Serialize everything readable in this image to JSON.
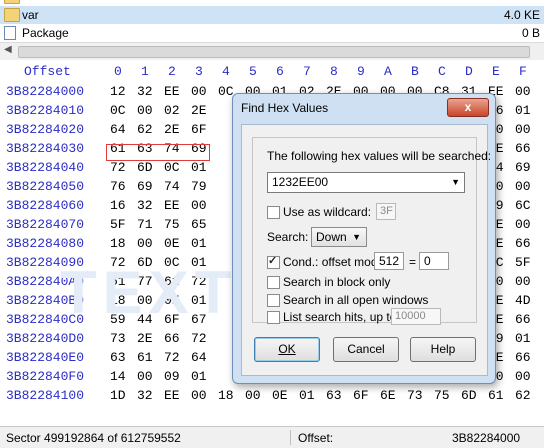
{
  "filelist": {
    "rows": [
      {
        "name": "",
        "size": "",
        "icon": "folder-icon"
      },
      {
        "name": "var",
        "size": "4.0 KE",
        "icon": "folder-icon"
      },
      {
        "name": "Package",
        "size": "0 B",
        "icon": "file-icon"
      }
    ]
  },
  "hex": {
    "offset_label": "Offset",
    "columns": [
      "0",
      "1",
      "2",
      "3",
      "4",
      "5",
      "6",
      "7",
      "8",
      "9",
      "A",
      "B",
      "C",
      "D",
      "E",
      "F"
    ],
    "rows": [
      {
        "offset": "3B82284000",
        "bytes": [
          "12",
          "32",
          "EE",
          "00",
          "0C",
          "00",
          "01",
          "02",
          "2E",
          "00",
          "00",
          "00",
          "C8",
          "31",
          "EE",
          "00"
        ]
      },
      {
        "offset": "3B82284010",
        "bytes": [
          "0C",
          "00",
          "02",
          "2E",
          "",
          "",
          "",
          "",
          "",
          "",
          "",
          "",
          "",
          "",
          "06",
          "01"
        ]
      },
      {
        "offset": "3B82284020",
        "bytes": [
          "64",
          "62",
          "2E",
          "6F",
          "",
          "",
          "",
          "",
          "",
          "",
          "",
          "",
          "",
          "",
          "00",
          "00"
        ]
      },
      {
        "offset": "3B82284030",
        "bytes": [
          "61",
          "63",
          "74",
          "69",
          "",
          "",
          "",
          "",
          "",
          "",
          "",
          "",
          "",
          "",
          "2E",
          "66"
        ]
      },
      {
        "offset": "3B82284040",
        "bytes": [
          "72",
          "6D",
          "0C",
          "01",
          "",
          "",
          "",
          "",
          "",
          "",
          "",
          "",
          "",
          "",
          "74",
          "69"
        ]
      },
      {
        "offset": "3B82284050",
        "bytes": [
          "76",
          "69",
          "74",
          "79",
          "",
          "",
          "",
          "",
          "",
          "",
          "",
          "",
          "",
          "",
          "00",
          "00"
        ]
      },
      {
        "offset": "3B82284060",
        "bytes": [
          "16",
          "32",
          "EE",
          "00",
          "",
          "",
          "",
          "",
          "",
          "",
          "",
          "",
          "",
          "",
          "69",
          "6C"
        ]
      },
      {
        "offset": "3B82284070",
        "bytes": [
          "5F",
          "71",
          "75",
          "65",
          "",
          "",
          "",
          "",
          "",
          "",
          "",
          "",
          "",
          "",
          "EE",
          "00"
        ]
      },
      {
        "offset": "3B82284080",
        "bytes": [
          "18",
          "00",
          "0E",
          "01",
          "",
          "",
          "",
          "",
          "",
          "",
          "",
          "",
          "",
          "",
          "2E",
          "66"
        ]
      },
      {
        "offset": "3B82284090",
        "bytes": [
          "72",
          "6D",
          "0C",
          "01",
          "",
          "",
          "",
          "",
          "",
          "",
          "",
          "",
          "",
          "",
          "6C",
          "5F"
        ]
      },
      {
        "offset": "3B822840A0",
        "bytes": [
          "61",
          "77",
          "61",
          "72",
          "",
          "",
          "",
          "",
          "",
          "",
          "",
          "",
          "",
          "",
          "00",
          "00"
        ]
      },
      {
        "offset": "3B822840B0",
        "bytes": [
          "18",
          "00",
          "0E",
          "01",
          "",
          "",
          "",
          "",
          "",
          "",
          "",
          "",
          "",
          "",
          "2E",
          "4D"
        ]
      },
      {
        "offset": "3B822840C0",
        "bytes": [
          "59",
          "44",
          "6F",
          "67",
          "",
          "",
          "",
          "",
          "",
          "",
          "",
          "",
          "",
          "",
          "2E",
          "66"
        ]
      },
      {
        "offset": "3B822840D0",
        "bytes": [
          "73",
          "2E",
          "66",
          "72",
          "",
          "",
          "",
          "",
          "",
          "",
          "",
          "",
          "",
          "",
          "09",
          "01"
        ]
      },
      {
        "offset": "3B822840E0",
        "bytes": [
          "63",
          "61",
          "72",
          "64",
          "",
          "",
          "",
          "",
          "",
          "",
          "",
          "",
          "",
          "",
          "2E",
          "66"
        ]
      },
      {
        "offset": "3B822840F0",
        "bytes": [
          "14",
          "00",
          "09",
          "01",
          "",
          "",
          "",
          "",
          "",
          "",
          "",
          "",
          "",
          "",
          "00",
          "00"
        ]
      },
      {
        "offset": "3B82284100",
        "bytes": [
          "1D",
          "32",
          "EE",
          "00",
          "18",
          "00",
          "0E",
          "01",
          "63",
          "6F",
          "6E",
          "73",
          "75",
          "6D",
          "61",
          "62"
        ]
      }
    ]
  },
  "watermark": "TEXT  TE",
  "status": {
    "sector": "Sector 499192864 of 612759552",
    "offset_label": "Offset:",
    "offset_value": "3B82284000"
  },
  "dialog": {
    "title": "Find Hex Values",
    "close": "x",
    "prompt": "The following hex values will be searched:",
    "search_value": "1232EE00",
    "wildcard_label": "Use as wildcard:",
    "wildcard_value": "3F",
    "search_label": "Search:",
    "search_direction": "Down",
    "cond_label": "Cond.: offset mod",
    "cond_mod": "512",
    "cond_eq": "=",
    "cond_value": "0",
    "block_only_label": "Search in block only",
    "all_windows_label": "Search in all open windows",
    "list_hits_label": "List search hits, up to",
    "list_hits_value": "10000",
    "ok": "OK",
    "cancel": "Cancel",
    "help": "Help"
  },
  "colors": {
    "offset_blue": "#2c2cc8",
    "selection_red": "#e03a3a",
    "dialog_frame": "#cfe0f3"
  }
}
